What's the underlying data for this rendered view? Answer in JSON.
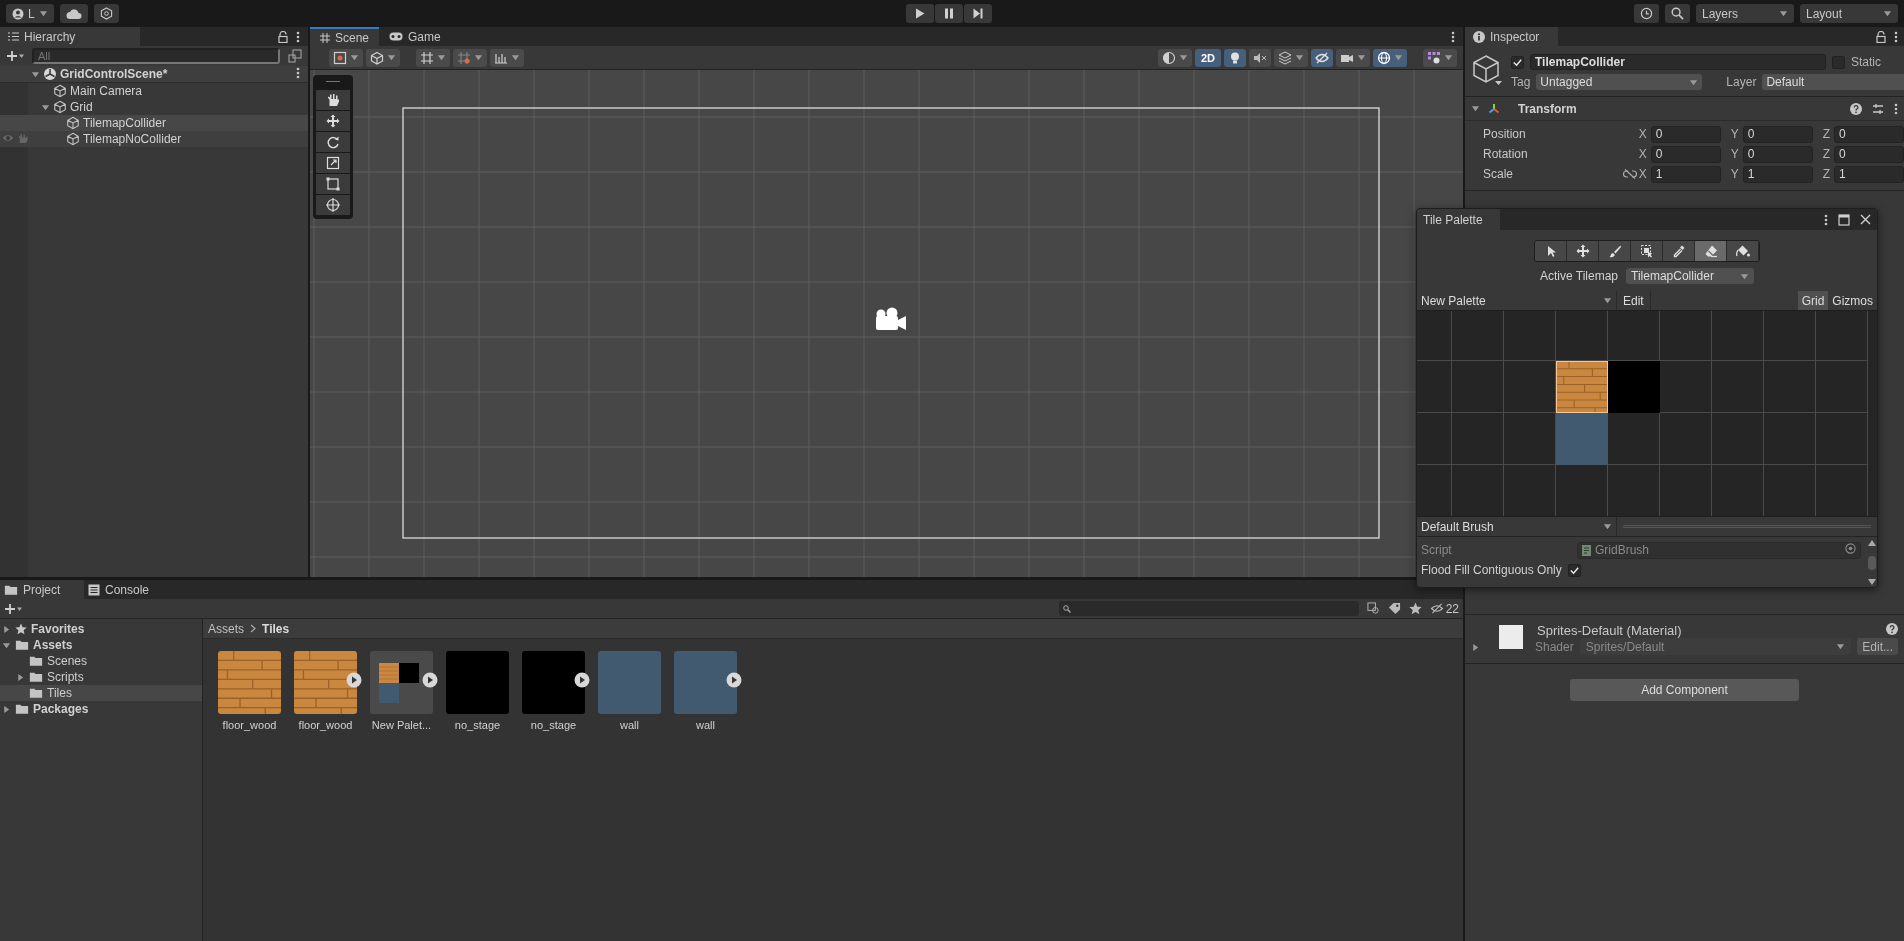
{
  "toolbar": {
    "account": "L",
    "layers": "Layers",
    "layout": "Layout"
  },
  "hierarchy": {
    "title": "Hierarchy",
    "search_placeholder": "All",
    "scene": {
      "name": "GridControlScene*",
      "expanded": true,
      "children": [
        {
          "name": "Main Camera",
          "selected": false,
          "hovered": false
        },
        {
          "name": "Grid",
          "expanded": true,
          "selected": false,
          "hovered": false,
          "children": [
            {
              "name": "TilemapCollider",
              "selected": true,
              "hovered": false
            },
            {
              "name": "TilemapNoCollider",
              "selected": false,
              "hovered": true
            }
          ]
        }
      ]
    }
  },
  "scene_view": {
    "tabs": [
      {
        "label": "Scene",
        "selected": true
      },
      {
        "label": "Game",
        "selected": false
      }
    ],
    "toggle_2d": {
      "label": "2D",
      "on": true
    }
  },
  "inspector": {
    "title": "Inspector",
    "object": {
      "active": true,
      "name": "TilemapCollider",
      "static": false,
      "static_label": "Static",
      "tag_label": "Tag",
      "tag": "Untagged",
      "layer_label": "Layer",
      "layer": "Default"
    },
    "transform": {
      "title": "Transform",
      "rows": [
        {
          "label": "Position",
          "values": [
            {
              "axis": "X",
              "value": "0"
            },
            {
              "axis": "Y",
              "value": "0"
            },
            {
              "axis": "Z",
              "value": "0"
            }
          ]
        },
        {
          "label": "Rotation",
          "values": [
            {
              "axis": "X",
              "value": "0"
            },
            {
              "axis": "Y",
              "value": "0"
            },
            {
              "axis": "Z",
              "value": "0"
            }
          ]
        },
        {
          "label": "Scale",
          "values": [
            {
              "axis": "X",
              "value": "1"
            },
            {
              "axis": "Y",
              "value": "1"
            },
            {
              "axis": "Z",
              "value": "1"
            }
          ]
        }
      ]
    },
    "material": {
      "name": "Sprites-Default (Material)",
      "shader_label": "Shader",
      "shader": "Sprites/Default",
      "edit": "Edit..."
    },
    "add_component": "Add Component"
  },
  "tile_palette": {
    "title": "Tile Palette",
    "tools": [
      {
        "kind": "select",
        "selected": false
      },
      {
        "kind": "move",
        "selected": false
      },
      {
        "kind": "paint",
        "selected": false
      },
      {
        "kind": "box",
        "selected": false
      },
      {
        "kind": "pick",
        "selected": false
      },
      {
        "kind": "erase",
        "selected": true
      },
      {
        "kind": "fill",
        "selected": false
      }
    ],
    "active_tilemap_label": "Active Tilemap",
    "active_tilemap": "TilemapCollider",
    "palette": "New Palette",
    "edit": "Edit",
    "grid": {
      "label": "Grid",
      "on": true
    },
    "gizmos": {
      "label": "Gizmos",
      "on": false
    },
    "cells": [
      [
        {
          "kind": "empty"
        },
        {
          "kind": "empty"
        },
        {
          "kind": "empty"
        },
        {
          "kind": "empty"
        },
        {
          "kind": "empty"
        },
        {
          "kind": "empty"
        },
        {
          "kind": "empty"
        },
        {
          "kind": "empty"
        },
        {
          "kind": "empty"
        }
      ],
      [
        {
          "kind": "empty"
        },
        {
          "kind": "empty"
        },
        {
          "kind": "empty"
        },
        {
          "kind": "wood"
        },
        {
          "kind": "black"
        },
        {
          "kind": "empty"
        },
        {
          "kind": "empty"
        },
        {
          "kind": "empty"
        },
        {
          "kind": "empty"
        }
      ],
      [
        {
          "kind": "empty"
        },
        {
          "kind": "empty"
        },
        {
          "kind": "empty"
        },
        {
          "kind": "wall"
        },
        {
          "kind": "empty"
        },
        {
          "kind": "empty"
        },
        {
          "kind": "empty"
        },
        {
          "kind": "empty"
        },
        {
          "kind": "empty"
        }
      ],
      [
        {
          "kind": "empty"
        },
        {
          "kind": "empty"
        },
        {
          "kind": "empty"
        },
        {
          "kind": "empty"
        },
        {
          "kind": "empty"
        },
        {
          "kind": "empty"
        },
        {
          "kind": "empty"
        },
        {
          "kind": "empty"
        },
        {
          "kind": "empty"
        }
      ]
    ],
    "brush": "Default Brush",
    "script_label": "Script",
    "script": "GridBrush",
    "flood_label": "Flood Fill Contiguous Only",
    "flood_checked": true
  },
  "project": {
    "tabs": [
      {
        "label": "Project",
        "selected": true
      },
      {
        "label": "Console",
        "selected": false
      }
    ],
    "count": "22",
    "tree": [
      {
        "name": "Favorites",
        "kind": "favorites",
        "expanded": false,
        "selected": false
      },
      {
        "name": "Assets",
        "kind": "folder",
        "expanded": true,
        "selected": false,
        "children": [
          {
            "name": "Scenes",
            "kind": "folder",
            "selected": false
          },
          {
            "name": "Scripts",
            "kind": "folder",
            "expanded": false,
            "selected": false
          },
          {
            "name": "Tiles",
            "kind": "folder",
            "selected": true
          }
        ]
      },
      {
        "name": "Packages",
        "kind": "folder",
        "expanded": false,
        "selected": false
      }
    ],
    "breadcrumb": [
      "Assets",
      "Tiles"
    ],
    "assets": [
      {
        "name": "floor_wood",
        "kind": "wood",
        "expandable": false
      },
      {
        "name": "floor_wood",
        "kind": "wood",
        "expandable": true
      },
      {
        "name": "New Palet...",
        "kind": "palette",
        "expandable": true
      },
      {
        "name": "no_stage",
        "kind": "black",
        "expandable": false
      },
      {
        "name": "no_stage",
        "kind": "black",
        "expandable": true
      },
      {
        "name": "wall",
        "kind": "wall",
        "expandable": false
      },
      {
        "name": "wall",
        "kind": "wall",
        "expandable": true
      }
    ]
  }
}
